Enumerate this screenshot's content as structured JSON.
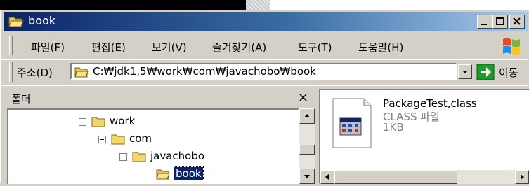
{
  "window": {
    "title": "book"
  },
  "menu": {
    "items": [
      {
        "label": "파일(",
        "key": "F",
        "end": ")"
      },
      {
        "label": "편집(",
        "key": "E",
        "end": ")"
      },
      {
        "label": "보기(",
        "key": "V",
        "end": ")"
      },
      {
        "label": "즐겨찾기(",
        "key": "A",
        "end": ")"
      },
      {
        "label": "도구(",
        "key": "T",
        "end": ")"
      },
      {
        "label": "도움말(",
        "key": "H",
        "end": ")"
      }
    ]
  },
  "address": {
    "label": "주소(D)",
    "path": "C:₩jdk1,5₩work₩com₩javachobo₩book",
    "go_label": "이동"
  },
  "folders": {
    "title": "폴더",
    "close": "×",
    "nodes": [
      "work",
      "com",
      "javachobo",
      "book"
    ],
    "selected": "book"
  },
  "files": [
    {
      "name": "PackageTest,class",
      "type": "CLASS 파일",
      "size": "1KB"
    }
  ],
  "icons": [
    "folder-open-icon",
    "windows-logo-icon",
    "go-arrow-icon",
    "class-file-icon",
    "minimize-icon",
    "maximize-icon",
    "close-icon"
  ],
  "colors": {
    "titlebar_start": "#0a246a",
    "titlebar_end": "#a6caf0",
    "selection": "#0a246a",
    "face": "#d4d0c8"
  }
}
